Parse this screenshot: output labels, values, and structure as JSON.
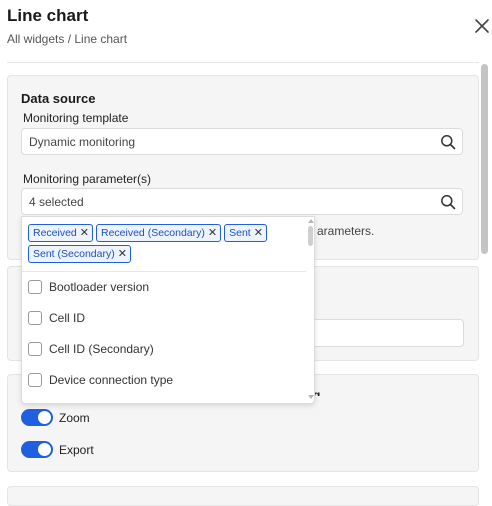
{
  "header": {
    "title": "Line chart",
    "breadcrumb": "All widgets / Line chart"
  },
  "data_source": {
    "title": "Data source",
    "template_label": "Monitoring template",
    "template_value": "Dynamic monitoring",
    "parameters_label": "Monitoring parameter(s)",
    "parameters_value": "4 selected",
    "hint_partial": "arameters."
  },
  "dropdown": {
    "chips": [
      "Received",
      "Received (Secondary)",
      "Sent",
      "Sent (Secondary)"
    ],
    "options": [
      "Bootloader version",
      "Cell ID",
      "Cell ID (Secondary)",
      "Device connection type"
    ]
  },
  "toggles": {
    "zoom_label": "Zoom",
    "export_label": "Export"
  },
  "colors": {
    "accent": "#1f5fe0",
    "chip_bg": "#eef4ff",
    "card_bg": "#f5f5f5"
  },
  "icons": [
    "close-icon",
    "search-icon",
    "chip-remove-icon"
  ]
}
